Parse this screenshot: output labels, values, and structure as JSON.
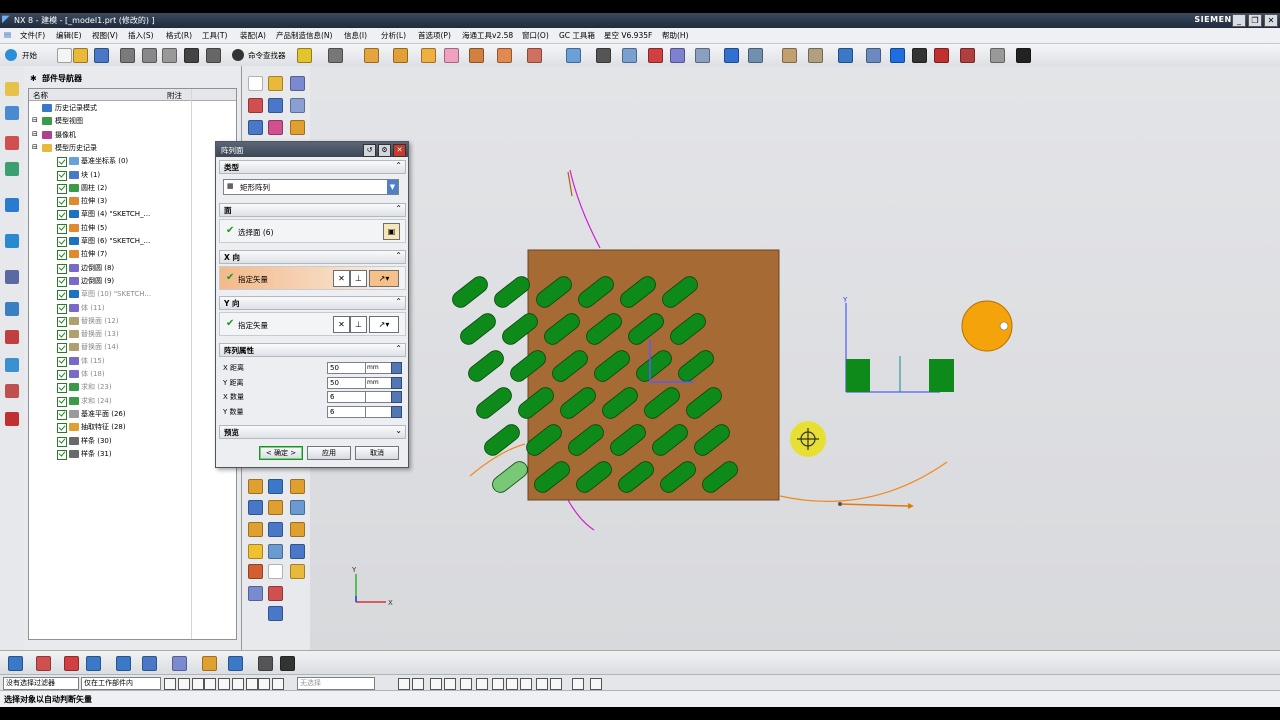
{
  "window": {
    "title": "NX 8 - 建模 - [_model1.prt (修改的) ]",
    "brand": "SIEMENS"
  },
  "menu": [
    "文件(F)",
    "编辑(E)",
    "视图(V)",
    "插入(S)",
    "格式(R)",
    "工具(T)",
    "装配(A)",
    "产品制造信息(N)",
    "信息(I)",
    "分析(L)",
    "首选项(P)",
    "海通工具v2.58",
    "窗口(O)",
    "GC 工具箱",
    "星空 V6.935F",
    "帮助(H)"
  ],
  "toolbar": {
    "start_label": "开始",
    "command_finder_label": "命令查找器"
  },
  "navigator": {
    "title": "部件导航器",
    "columns": {
      "name": "名称",
      "note": "附注"
    },
    "top_items": [
      "历史记录模式",
      "模型视图",
      "摄像机",
      "模型历史记录"
    ],
    "features": [
      {
        "label": "基准坐标系 (0)",
        "dim": false
      },
      {
        "label": "块 (1)",
        "dim": false
      },
      {
        "label": "圆柱 (2)",
        "dim": false
      },
      {
        "label": "拉伸 (3)",
        "dim": false
      },
      {
        "label": "草图 (4) \"SKETCH_...",
        "dim": false
      },
      {
        "label": "拉伸 (5)",
        "dim": false
      },
      {
        "label": "草图 (6) \"SKETCH_...",
        "dim": false
      },
      {
        "label": "拉伸 (7)",
        "dim": false
      },
      {
        "label": "边倒圆 (8)",
        "dim": false
      },
      {
        "label": "边倒圆 (9)",
        "dim": false
      },
      {
        "label": "草图 (10) \"SKETCH...",
        "dim": true
      },
      {
        "label": "体 (11)",
        "dim": true
      },
      {
        "label": "替换面 (12)",
        "dim": true
      },
      {
        "label": "替换面 (13)",
        "dim": true
      },
      {
        "label": "替换面 (14)",
        "dim": true
      },
      {
        "label": "体 (15)",
        "dim": true
      },
      {
        "label": "体 (18)",
        "dim": true
      },
      {
        "label": "求和 (23)",
        "dim": true
      },
      {
        "label": "求和 (24)",
        "dim": true
      },
      {
        "label": "基准平面 (26)",
        "dim": false
      },
      {
        "label": "抽取特征 (28)",
        "dim": false
      },
      {
        "label": "样条 (30)",
        "dim": false
      },
      {
        "label": "样条 (31)",
        "dim": false
      }
    ]
  },
  "dialog": {
    "title": "阵列面",
    "type_section": "类型",
    "type_value": "矩形阵列",
    "face_section": "面",
    "face_select_label": "选择面 (6)",
    "x_dir_section": "X 向",
    "x_dir_label": "指定矢量",
    "y_dir_section": "Y 向",
    "y_dir_label": "指定矢量",
    "props_section": "阵列属性",
    "fields": [
      {
        "label": "X 距离",
        "value": "50",
        "unit": "mm"
      },
      {
        "label": "Y 距离",
        "value": "50",
        "unit": "mm"
      },
      {
        "label": "X 数量",
        "value": "6",
        "unit": ""
      },
      {
        "label": "Y 数量",
        "value": "6",
        "unit": ""
      }
    ],
    "preview_section": "预览",
    "ok": "< 确定 >",
    "apply": "应用",
    "cancel": "取消"
  },
  "selection_bar": {
    "filter": "没有选择过滤器",
    "scope": "仅在工作部件内",
    "blank": "无选择"
  },
  "status": "选择对象以自动判断矢量",
  "colors": {
    "block": "#a66a34",
    "slot": "#0e8a1a",
    "slot_preview": "#78c878",
    "sphere": "#f5a30a"
  },
  "viewport": {
    "triad_x": "X",
    "triad_y": "Y"
  }
}
